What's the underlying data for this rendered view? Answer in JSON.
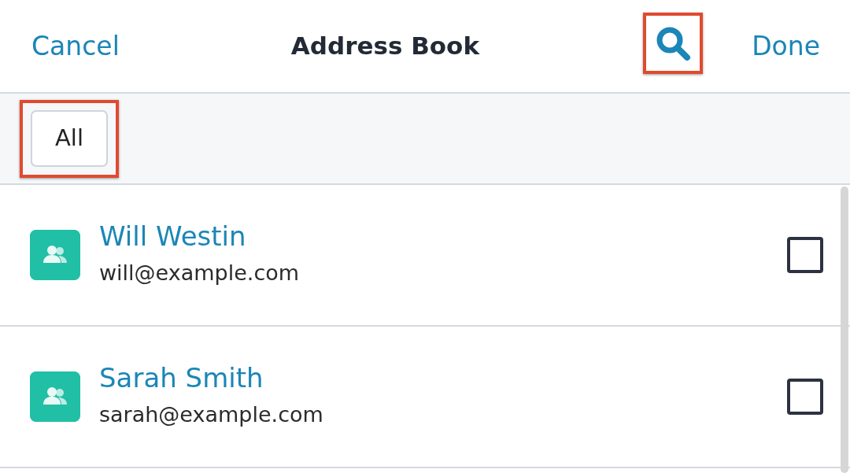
{
  "header": {
    "cancel": "Cancel",
    "title": "Address Book",
    "done": "Done",
    "search": {
      "highlighted": true
    }
  },
  "filters": [
    {
      "label": "All",
      "highlighted": true
    }
  ],
  "contacts": [
    {
      "name": "Will Westin",
      "email": "will@example.com",
      "checked": false
    },
    {
      "name": "Sarah Smith",
      "email": "sarah@example.com",
      "checked": false
    }
  ]
}
